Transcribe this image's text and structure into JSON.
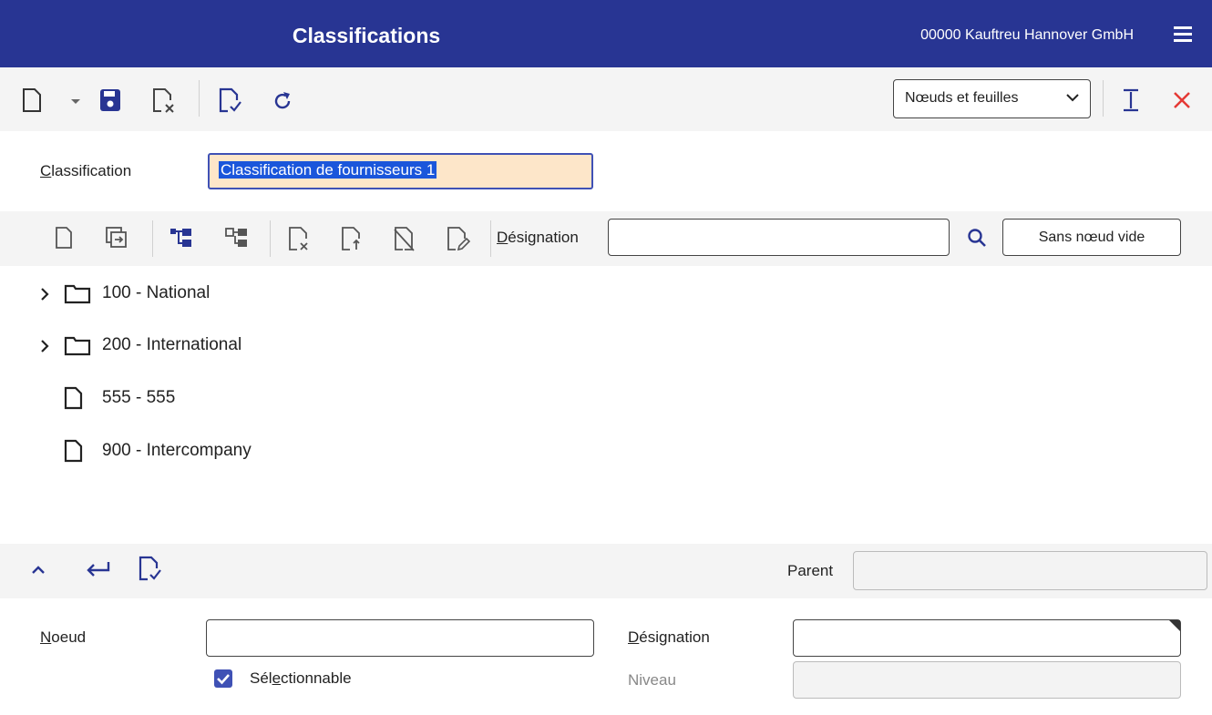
{
  "header": {
    "title": "Classifications",
    "company": "00000  Kauftreu Hannover GmbH"
  },
  "toolbar": {
    "view_select": "Nœuds et feuilles"
  },
  "classification": {
    "label_first": "C",
    "label_rest": "lassification",
    "value": "Classification de fournisseurs 1"
  },
  "tree_toolbar": {
    "designation_first": "D",
    "designation_rest": "ésignation",
    "designation_value": "",
    "filter_button": "Sans nœud vide"
  },
  "tree": {
    "items": [
      {
        "label": "100 - National",
        "type": "folder"
      },
      {
        "label": "200 - International",
        "type": "folder"
      },
      {
        "label": "555 - 555",
        "type": "leaf"
      },
      {
        "label": "900 - Intercompany",
        "type": "leaf"
      }
    ]
  },
  "detail_toolbar": {
    "parent_label": "Parent",
    "parent_value": ""
  },
  "form": {
    "noeud_first": "N",
    "noeud_rest": "oeud",
    "noeud_value": "",
    "designation_first": "D",
    "designation_rest": "ésignation",
    "designation_value": "",
    "selectable_pre": "Sél",
    "selectable_u": "e",
    "selectable_post": "ctionnable",
    "selectable_checked": true,
    "niveau_label": "Niveau",
    "niveau_value": ""
  },
  "colors": {
    "header_bg": "#283593",
    "accent": "#3f51b5",
    "close": "#e53935",
    "selected_input_bg": "#fde6c9"
  }
}
